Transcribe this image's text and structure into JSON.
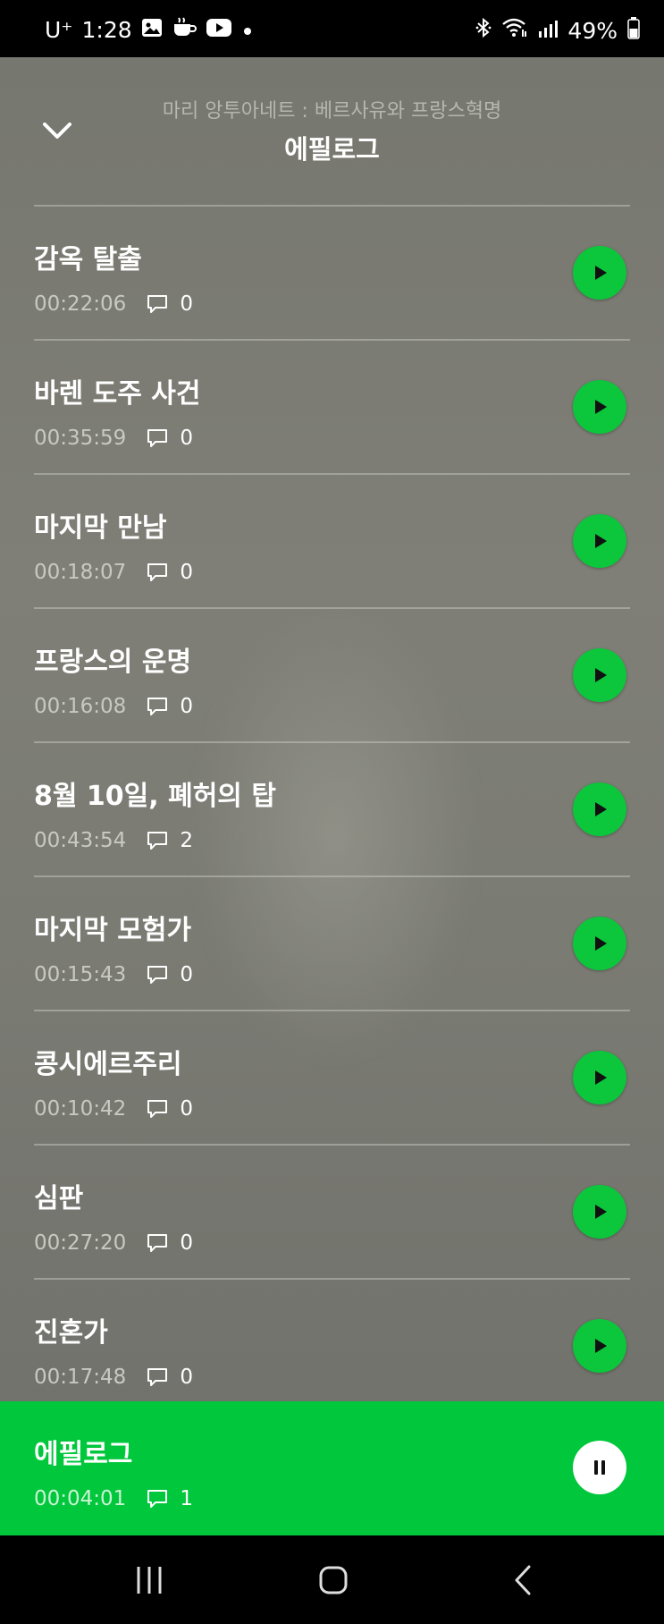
{
  "status_bar": {
    "carrier": "U⁺",
    "time": "1:28",
    "battery": "49%",
    "icons": [
      "gallery-icon",
      "coffee-icon",
      "youtube-icon",
      "dot-icon",
      "bluetooth-icon",
      "wifi-icon",
      "signal-icon",
      "battery-icon"
    ]
  },
  "header": {
    "subtitle": "마리 앙투아네트 : 베르사유와 프랑스혁명",
    "title": "에필로그",
    "back_icon": "chevron-down-icon"
  },
  "episodes": [
    {
      "title": "감옥 탈출",
      "duration": "00:22:06",
      "comments": "0"
    },
    {
      "title": "바렌 도주 사건",
      "duration": "00:35:59",
      "comments": "0"
    },
    {
      "title": "마지막 만남",
      "duration": "00:18:07",
      "comments": "0"
    },
    {
      "title": "프랑스의 운명",
      "duration": "00:16:08",
      "comments": "0"
    },
    {
      "title": "8월 10일, 폐허의 탑",
      "duration": "00:43:54",
      "comments": "2"
    },
    {
      "title": "마지막 모험가",
      "duration": "00:15:43",
      "comments": "0"
    },
    {
      "title": "콩시에르주리",
      "duration": "00:10:42",
      "comments": "0"
    },
    {
      "title": "심판",
      "duration": "00:27:20",
      "comments": "0"
    },
    {
      "title": "진혼가",
      "duration": "00:17:48",
      "comments": "0"
    }
  ],
  "now_playing": {
    "title": "에필로그",
    "duration": "00:04:01",
    "comments": "1"
  },
  "colors": {
    "accent": "#00c73c",
    "play_button": "#0cc63c"
  }
}
